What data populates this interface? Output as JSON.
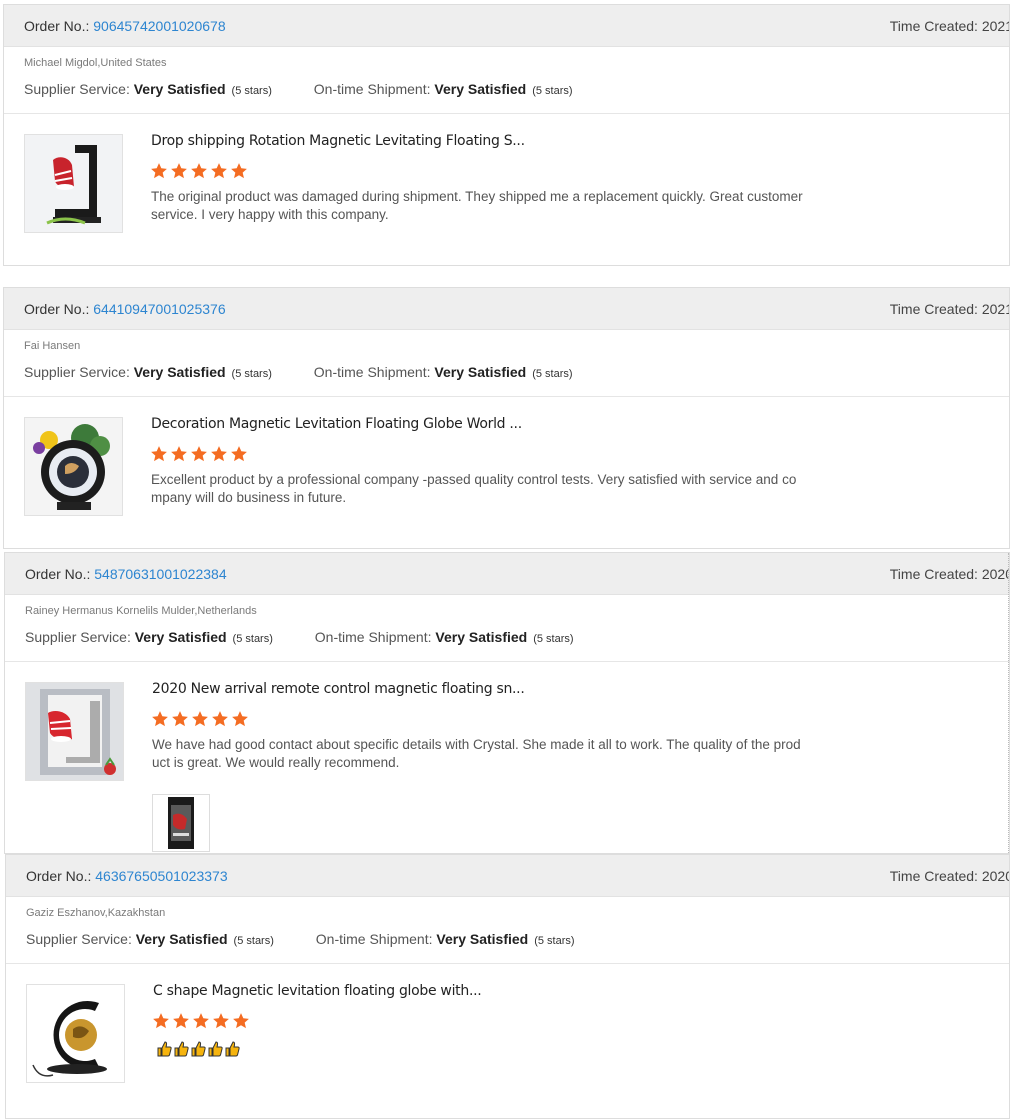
{
  "labels": {
    "order_no": "Order No.:",
    "time_created": "Time Created:",
    "supplier_service": "Supplier Service:",
    "ontime_shipment": "On-time Shipment:"
  },
  "reviews": [
    {
      "order_number": "90645742001020678",
      "time_created_value": "2021",
      "buyer": "Michael Migdol,United States",
      "supplier_service": "Very Satisfied",
      "supplier_stars": "(5 stars)",
      "shipment": "Very Satisfied",
      "shipment_stars": "(5 stars)",
      "product_title": "Drop shipping Rotation Magnetic Levitating Floating S...",
      "rating": 5,
      "comment": "The original product was damaged during shipment. They shipped me a replacement quickly. Great customer service. I very happy with this company.",
      "thumb_icon": "levitating-shoe-image"
    },
    {
      "order_number": "64410947001025376",
      "time_created_value": "2021",
      "buyer": "Fai Hansen",
      "supplier_service": "Very Satisfied",
      "supplier_stars": "(5 stars)",
      "shipment": "Very Satisfied",
      "shipment_stars": "(5 stars)",
      "product_title": "Decoration Magnetic Levitation Floating Globe World ...",
      "rating": 5,
      "comment": "Excellent product by a professional company -passed quality control tests. Very satisfied with service and company will do business in future.",
      "thumb_icon": "floating-globe-image"
    },
    {
      "order_number": "54870631001022384",
      "time_created_value": "2020",
      "buyer": "Rainey Hermanus Kornelils Mulder,Netherlands",
      "supplier_service": "Very Satisfied",
      "supplier_stars": "(5 stars)",
      "shipment": "Very Satisfied",
      "shipment_stars": "(5 stars)",
      "product_title": "2020 New arrival remote control magnetic floating sn...",
      "rating": 5,
      "comment": "We have had good contact about specific details with Crystal. She made it all to work. The quality of the product is great. We would really recommend.",
      "thumb_icon": "floating-sneaker-image"
    },
    {
      "order_number": "46367650501023373",
      "time_created_value": "2020",
      "buyer": "Gaziz Eszhanov,Kazakhstan",
      "supplier_service": "Very Satisfied",
      "supplier_stars": "(5 stars)",
      "shipment": "Very Satisfied",
      "shipment_stars": "(5 stars)",
      "product_title": "C shape Magnetic levitation floating globe with...",
      "rating": 5,
      "comment": "",
      "emoji": "👍👍👍👍👍",
      "thumb_icon": "c-shape-globe-image"
    }
  ],
  "colors": {
    "star": "#f46c22",
    "link": "#2d85d0",
    "header_bg": "#eeeeee"
  }
}
